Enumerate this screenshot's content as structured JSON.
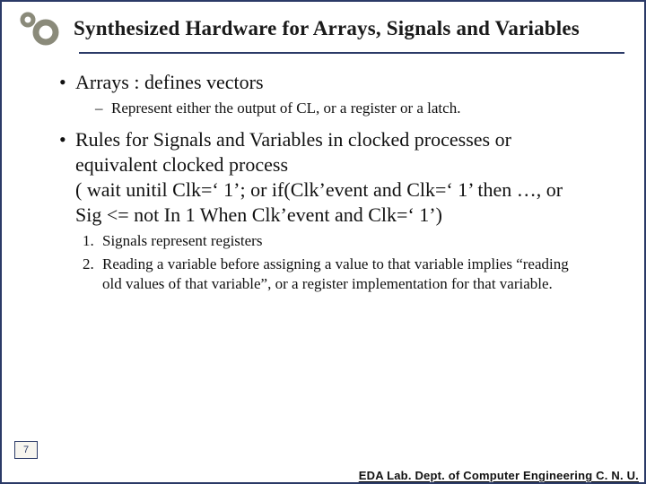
{
  "title": "Synthesized Hardware for Arrays, Signals and Variables",
  "bullets": [
    {
      "text": "Arrays : defines vectors",
      "sub": "Represent either the output of CL, or a register or a latch."
    },
    {
      "text": "Rules for Signals and Variables in clocked processes or equivalent clocked process\n( wait unitil Clk=‘ 1’; or if(Clk’event and Clk=‘ 1’ then …, or Sig <= not In 1 When Clk’event and Clk=‘ 1’)",
      "numbered": [
        "Signals represent registers",
        "Reading a variable before assigning a value to that variable implies “reading old values of that variable”, or a register implementation for that variable."
      ]
    }
  ],
  "page_number": "7",
  "footer": "EDA Lab. Dept. of Computer Engineering C. N. U."
}
